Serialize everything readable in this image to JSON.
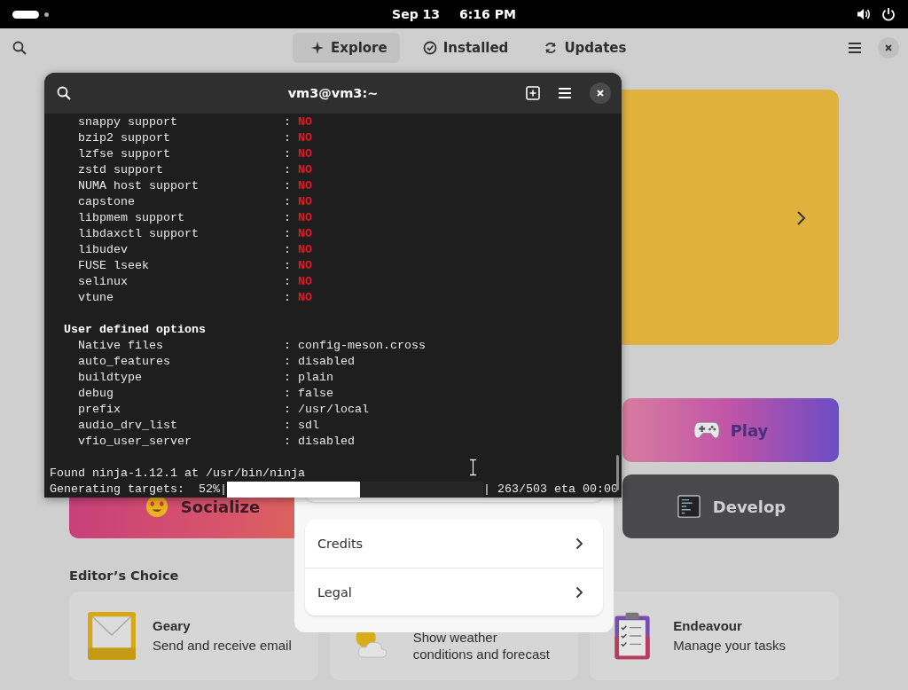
{
  "top_bar": {
    "date": "Sep 13",
    "time": "6:16 PM"
  },
  "software": {
    "tabs": [
      {
        "label": "Explore",
        "kind": "explore",
        "selected": true
      },
      {
        "label": "Installed",
        "kind": "installed",
        "selected": false
      },
      {
        "label": "Updates",
        "kind": "updates",
        "selected": false
      }
    ],
    "categories": [
      {
        "label": "Play",
        "kind": "play"
      },
      {
        "label": "Socialize",
        "kind": "socialize"
      },
      {
        "label": "Develop",
        "kind": "develop"
      }
    ],
    "section_title": "Editor’s Choice",
    "apps": [
      {
        "name": "Geary",
        "description": "Send and receive email",
        "kind": "mail"
      },
      {
        "description": "Show weather conditions and forecast",
        "kind": "weather"
      },
      {
        "name": "Endeavour",
        "description": "Manage your tasks",
        "kind": "tasks"
      }
    ]
  },
  "dialog": {
    "rows": [
      {
        "label": "Credits"
      },
      {
        "label": "Legal"
      }
    ]
  },
  "terminal": {
    "title": "vm3@vm3:~",
    "lines": [
      {
        "kind": "option",
        "label": "snappy support",
        "separator": ":",
        "value": "NO",
        "alert": true
      },
      {
        "kind": "option",
        "label": "bzip2 support",
        "separator": ":",
        "value": "NO",
        "alert": true
      },
      {
        "kind": "option",
        "label": "lzfse support",
        "separator": ":",
        "value": "NO",
        "alert": true
      },
      {
        "kind": "option",
        "label": "zstd support",
        "separator": ":",
        "value": "NO",
        "alert": true
      },
      {
        "kind": "option",
        "label": "NUMA host support",
        "separator": ":",
        "value": "NO",
        "alert": true
      },
      {
        "kind": "option",
        "label": "capstone",
        "separator": ":",
        "value": "NO",
        "alert": true
      },
      {
        "kind": "option",
        "label": "libpmem support",
        "separator": ":",
        "value": "NO",
        "alert": true
      },
      {
        "kind": "option",
        "label": "libdaxctl support",
        "separator": ":",
        "value": "NO",
        "alert": true
      },
      {
        "kind": "option",
        "label": "libudev",
        "separator": ":",
        "value": "NO",
        "alert": true
      },
      {
        "kind": "option",
        "label": "FUSE lseek",
        "separator": ":",
        "value": "NO",
        "alert": true
      },
      {
        "kind": "option",
        "label": "selinux",
        "separator": ":",
        "value": "NO",
        "alert": true
      },
      {
        "kind": "option",
        "label": "vtune",
        "separator": ":",
        "value": "NO",
        "alert": true
      },
      {
        "kind": "blank"
      },
      {
        "kind": "heading",
        "text": "User defined options"
      },
      {
        "kind": "option",
        "label": "Native files",
        "separator": ":",
        "value": "config-meson.cross",
        "alert": false
      },
      {
        "kind": "option",
        "label": "auto_features",
        "separator": ":",
        "value": "disabled",
        "alert": false
      },
      {
        "kind": "option",
        "label": "buildtype",
        "separator": ":",
        "value": "plain",
        "alert": false
      },
      {
        "kind": "option",
        "label": "debug",
        "separator": ":",
        "value": "false",
        "alert": false
      },
      {
        "kind": "option",
        "label": "prefix",
        "separator": ":",
        "value": "/usr/local",
        "alert": false
      },
      {
        "kind": "option",
        "label": "audio_drv_list",
        "separator": ":",
        "value": "sdl",
        "alert": false
      },
      {
        "kind": "option",
        "label": "vfio_user_server",
        "separator": ":",
        "value": "disabled",
        "alert": false
      },
      {
        "kind": "blank"
      },
      {
        "kind": "plain",
        "text": "Found ninja-1.12.1 at /usr/bin/ninja"
      }
    ],
    "progress": {
      "label": "Generating targets:  52%|",
      "level": 0.52,
      "tail": "| 263/503 eta 00:00"
    }
  }
}
